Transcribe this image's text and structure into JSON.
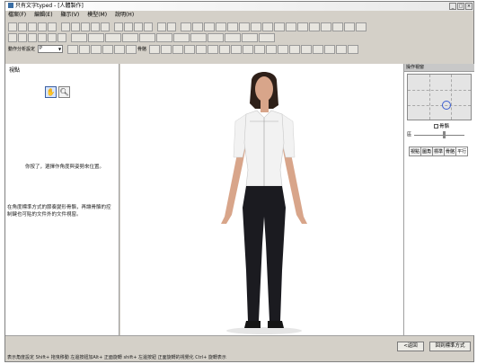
{
  "window": {
    "title": "只有文字typed - [人體製作]"
  },
  "menu": [
    "檔案(F)",
    "編輯(E)",
    "顯示(V)",
    "模型(M)",
    "說明(H)"
  ],
  "toolbar3": {
    "label": "動作分析設定",
    "combo_value": "P",
    "label2": "骨骼"
  },
  "left_panel": {
    "title": "視點",
    "tip1": "你按了，選擇作角度與姿勢來位置。",
    "tip2": "在角度標準方式的節奏變形骨骼，再讓骨骼的控制鍵也可貼的文件外的文件視窗。"
  },
  "right_panel": {
    "title": "操作視窗",
    "checkbox_label": "骨骼",
    "slider_label": "區",
    "tabs": [
      "視點",
      "圖角",
      "標準",
      "骨骼",
      "平行"
    ]
  },
  "bottom": {
    "back_button": "<返回",
    "reset_button": "回到標準方式"
  },
  "status": "表示角度設定 Shift+ 拖曳移動 左邊按鈕加Alt+ 正面旋轉 shift+ 左邊按鈕 正面旋轉的視覺化 Ctrl+ 旋轉表示",
  "figure": {
    "skin": "#d8a58a",
    "hair": "#2e2019",
    "shirt": "#f2f2f2",
    "pants": "#1b1b20",
    "shoes": "#151515"
  }
}
